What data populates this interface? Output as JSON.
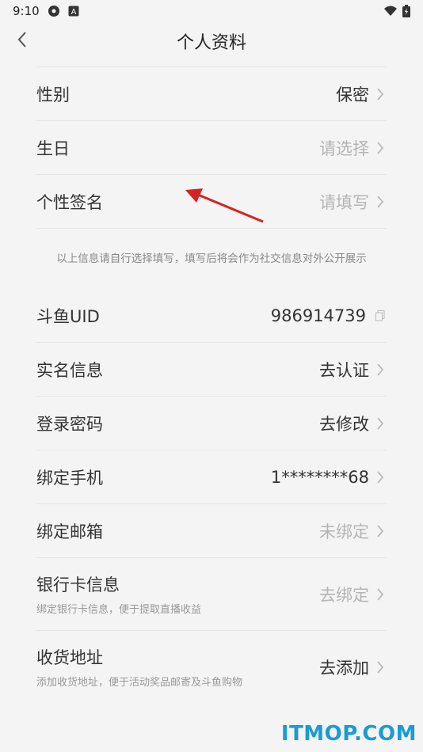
{
  "status_bar": {
    "time": "9:10",
    "icons_left": [
      "settings-icon",
      "a-icon"
    ],
    "icons_right": [
      "wifi-icon",
      "battery-icon"
    ]
  },
  "nav": {
    "title": "个人资料"
  },
  "profile_rows": [
    {
      "label": "性别",
      "value": "保密",
      "placeholder": false
    },
    {
      "label": "生日",
      "value": "请选择",
      "placeholder": true
    },
    {
      "label": "个性签名",
      "value": "请填写",
      "placeholder": true
    }
  ],
  "note": "以上信息请自行选择填写，填写后将会作为社交信息对外公开展示",
  "account_rows": [
    {
      "label": "斗鱼UID",
      "value": "986914739"
    },
    {
      "label": "实名信息",
      "value": "去认证"
    },
    {
      "label": "登录密码",
      "value": "去修改"
    },
    {
      "label": "绑定手机",
      "value": "1********68"
    },
    {
      "label": "绑定邮箱",
      "value": "未绑定"
    },
    {
      "label": "银行卡信息",
      "sub": "绑定银行卡信息，便于提取直播收益",
      "value": "去绑定"
    },
    {
      "label": "收货地址",
      "sub": "添加收货地址，便于活动奖品邮寄及斗鱼购物",
      "value": "去添加"
    }
  ],
  "watermark": "ITMOP.COM",
  "colors": {
    "placeholder": "#b5b5b5",
    "watermark": "#1a9bd7",
    "arrow": "#d42424"
  }
}
